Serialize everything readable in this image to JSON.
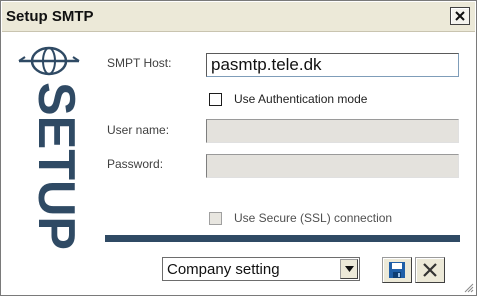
{
  "window": {
    "title": "Setup SMTP",
    "side_logo_text": "SETUP"
  },
  "form": {
    "host_label": "SMPT Host:",
    "host_value": "pasmtp.tele.dk",
    "auth_label": "Use Authentication mode",
    "auth_checked": false,
    "username_label": "User name:",
    "username_value": "",
    "password_label": "Password:",
    "password_value": "",
    "ssl_label": "Use Secure (SSL) connection",
    "ssl_checked": false
  },
  "footer": {
    "preset_value": "Company setting"
  },
  "icons": {
    "close": "close-icon",
    "save": "save-icon",
    "cancel": "cancel-icon",
    "dropdown": "chevron-down-icon",
    "logo": "globe-icon"
  },
  "colors": {
    "logo": "#2f4a64",
    "separator": "#2f4a64",
    "save_icon": "#1f5fa8"
  }
}
